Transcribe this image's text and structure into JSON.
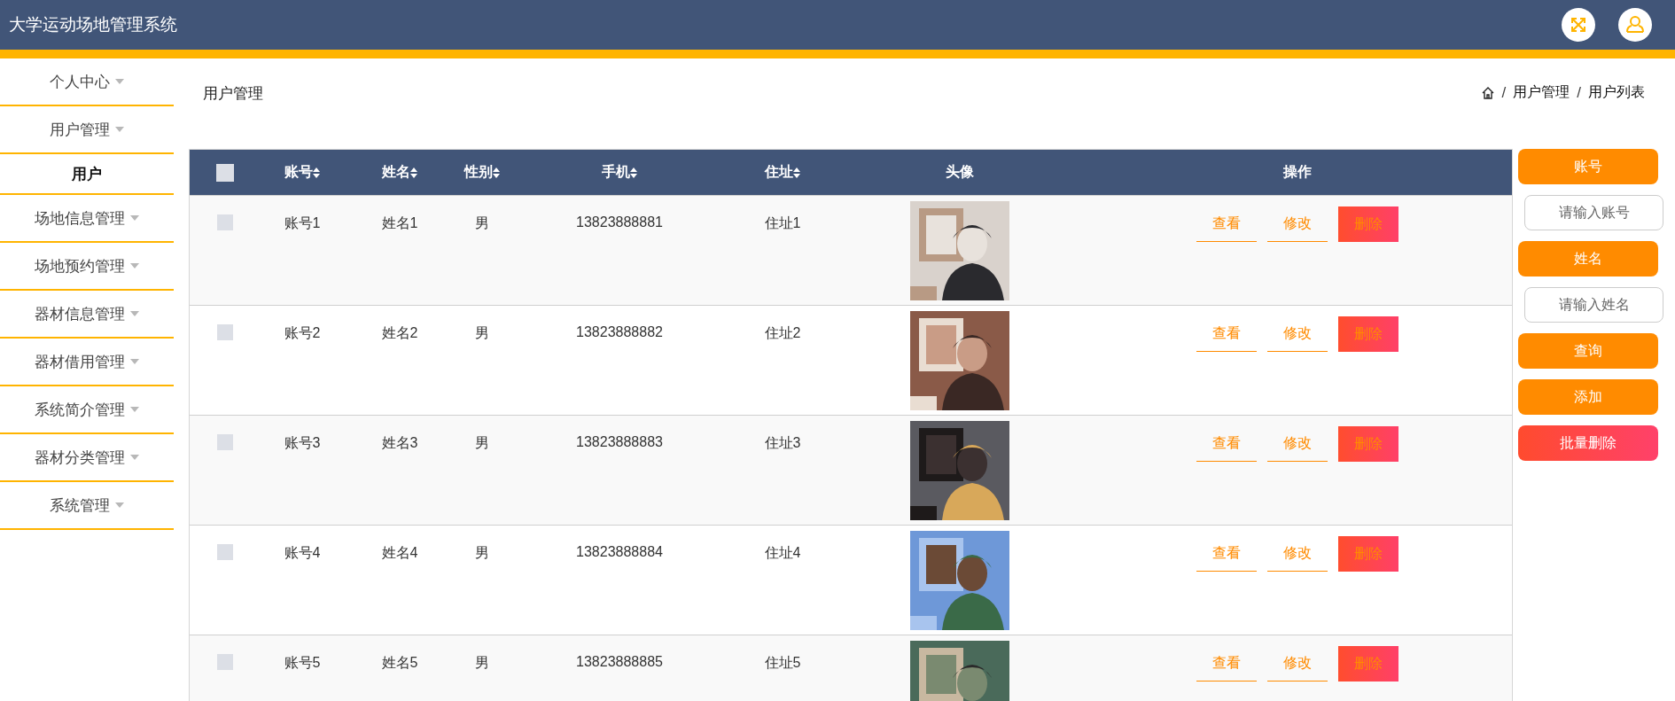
{
  "header": {
    "title": "大学运动场地管理系统"
  },
  "sidebar": {
    "items": [
      {
        "label": "个人中心",
        "selected": false
      },
      {
        "label": "用户管理",
        "selected": false,
        "children": [
          {
            "label": "用户",
            "selected": true
          }
        ]
      },
      {
        "label": "场地信息管理",
        "selected": false
      },
      {
        "label": "场地预约管理",
        "selected": false
      },
      {
        "label": "器材信息管理",
        "selected": false
      },
      {
        "label": "器材借用管理",
        "selected": false
      },
      {
        "label": "系统简介管理",
        "selected": false
      },
      {
        "label": "器材分类管理",
        "selected": false
      },
      {
        "label": "系统管理",
        "selected": false
      }
    ]
  },
  "page": {
    "title": "用户管理",
    "breadcrumb": [
      {
        "kind": "separator",
        "text": "/"
      },
      {
        "kind": "link",
        "text": "用户管理"
      },
      {
        "kind": "separator",
        "text": "/"
      },
      {
        "kind": "link",
        "text": "用户列表"
      }
    ]
  },
  "table": {
    "columns": [
      {
        "label": "账号",
        "sortable": true
      },
      {
        "label": "姓名",
        "sortable": true
      },
      {
        "label": "性别",
        "sortable": true
      },
      {
        "label": "手机",
        "sortable": true
      },
      {
        "label": "住址",
        "sortable": true
      },
      {
        "label": "头像",
        "sortable": false
      },
      {
        "label": "操作",
        "sortable": false
      }
    ],
    "header_checked": false,
    "rows": [
      {
        "checked": false,
        "cells": [
          "账号1",
          "姓名1",
          "男",
          "13823888881",
          "住址1"
        ],
        "avatar": {
          "kind": "picture"
        },
        "actions": [
          {
            "kind": "link",
            "label": "查看"
          },
          {
            "kind": "link",
            "label": "修改"
          },
          {
            "kind": "danger",
            "label": "删除"
          }
        ]
      },
      {
        "checked": false,
        "cells": [
          "账号2",
          "姓名2",
          "男",
          "13823888882",
          "住址2"
        ],
        "avatar": {
          "kind": "picture"
        },
        "actions": [
          {
            "kind": "link",
            "label": "查看"
          },
          {
            "kind": "link",
            "label": "修改"
          },
          {
            "kind": "danger",
            "label": "删除"
          }
        ]
      },
      {
        "checked": false,
        "cells": [
          "账号3",
          "姓名3",
          "男",
          "13823888883",
          "住址3"
        ],
        "avatar": {
          "kind": "picture"
        },
        "actions": [
          {
            "kind": "link",
            "label": "查看"
          },
          {
            "kind": "link",
            "label": "修改"
          },
          {
            "kind": "danger",
            "label": "删除"
          }
        ]
      },
      {
        "checked": false,
        "cells": [
          "账号4",
          "姓名4",
          "男",
          "13823888884",
          "住址4"
        ],
        "avatar": {
          "kind": "picture"
        },
        "actions": [
          {
            "kind": "link",
            "label": "查看"
          },
          {
            "kind": "link",
            "label": "修改"
          },
          {
            "kind": "danger",
            "label": "删除"
          }
        ]
      },
      {
        "checked": false,
        "cells": [
          "账号5",
          "姓名5",
          "男",
          "13823888885",
          "住址5"
        ],
        "avatar": {
          "kind": "picture"
        },
        "actions": [
          {
            "kind": "link",
            "label": "查看"
          },
          {
            "kind": "link",
            "label": "修改"
          },
          {
            "kind": "danger",
            "label": "删除"
          }
        ]
      }
    ]
  },
  "search_panel": [
    {
      "kind": "label",
      "text": "账号"
    },
    {
      "kind": "input",
      "placeholder": "请输入账号"
    },
    {
      "kind": "label",
      "text": "姓名"
    },
    {
      "kind": "input",
      "placeholder": "请输入姓名"
    },
    {
      "kind": "button",
      "text": "查询"
    },
    {
      "kind": "button",
      "text": "添加"
    },
    {
      "kind": "danger",
      "text": "批量删除"
    }
  ]
}
